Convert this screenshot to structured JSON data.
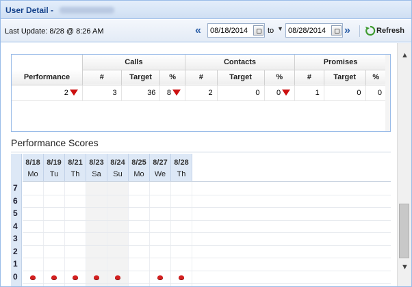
{
  "window": {
    "title": "User Detail -"
  },
  "toolbar": {
    "last_update": "Last Update: 8/28 @ 8:26 AM",
    "start_date": "08/18/2014",
    "to_label": "to",
    "end_date": "08/28/2014",
    "refresh_label": "Refresh"
  },
  "summary": {
    "group_headers": [
      "Calls",
      "Contacts",
      "Promises"
    ],
    "column_headers": [
      "Performance",
      "#",
      "Target",
      "%",
      "#",
      "Target",
      "%",
      "#",
      "Target",
      "%"
    ],
    "row": {
      "performance": "2",
      "calls_count": "3",
      "calls_target": "36",
      "calls_pct": "8",
      "contacts_count": "2",
      "contacts_target": "0",
      "contacts_pct": "0",
      "promises_count": "1",
      "promises_target": "0",
      "promises_pct": "0"
    }
  },
  "performance_scores": {
    "title": "Performance Scores",
    "days": [
      {
        "date": "8/18",
        "weekday": "Mo",
        "score": 0
      },
      {
        "date": "8/19",
        "weekday": "Tu",
        "score": 0
      },
      {
        "date": "8/21",
        "weekday": "Th",
        "score": 0
      },
      {
        "date": "8/23",
        "weekday": "Sa",
        "score": 0
      },
      {
        "date": "8/24",
        "weekday": "Su",
        "score": 0
      },
      {
        "date": "8/25",
        "weekday": "Mo",
        "score": null
      },
      {
        "date": "8/27",
        "weekday": "We",
        "score": 0
      },
      {
        "date": "8/28",
        "weekday": "Th",
        "score": 0
      }
    ],
    "y_labels": [
      "7",
      "6",
      "5",
      "4",
      "3",
      "2",
      "1",
      "0"
    ],
    "dot_color": "#d42020"
  },
  "colors": {
    "accent": "#15428b",
    "arrow_down": "#cc1010"
  }
}
